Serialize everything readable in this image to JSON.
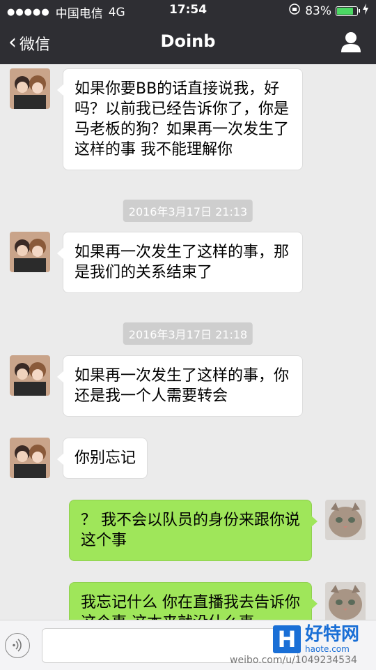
{
  "status": {
    "carrier": "中国电信",
    "network": "4G",
    "time": "17:54",
    "battery": "83%",
    "battery_level": 0.83
  },
  "nav": {
    "back_label": "微信",
    "title": "Doinb"
  },
  "messages": [
    {
      "side": "in",
      "text": "如果你要BB的话直接说我，好吗？以前我已经告诉你了，你是马老板的狗？如果再一次发生了这样的事 我不能理解你"
    },
    {
      "type": "time",
      "text": "2016年3月17日 21:13"
    },
    {
      "side": "in",
      "text": "如果再一次发生了这样的事，那是我们的关系结束了"
    },
    {
      "type": "time",
      "text": "2016年3月17日 21:18"
    },
    {
      "side": "in",
      "text": "如果再一次发生了这样的事，你还是我一个人需要转会"
    },
    {
      "side": "in",
      "text": "你别忘记"
    },
    {
      "side": "out",
      "text": "？  我不会以队员的身份来跟你说这个事"
    },
    {
      "side": "out",
      "text": "我忘记什么  你在直播我去告诉你这个事  这本来就没什么事"
    }
  ],
  "watermark": {
    "name": "好特网",
    "domain": "haote.com",
    "logo": "H",
    "weibo": "weibo.com/u/1049234534"
  },
  "colors": {
    "nav_bg": "#2e2e33",
    "chat_bg": "#ebebeb",
    "out_bubble": "#9fe65a",
    "in_bubble": "#ffffff"
  }
}
